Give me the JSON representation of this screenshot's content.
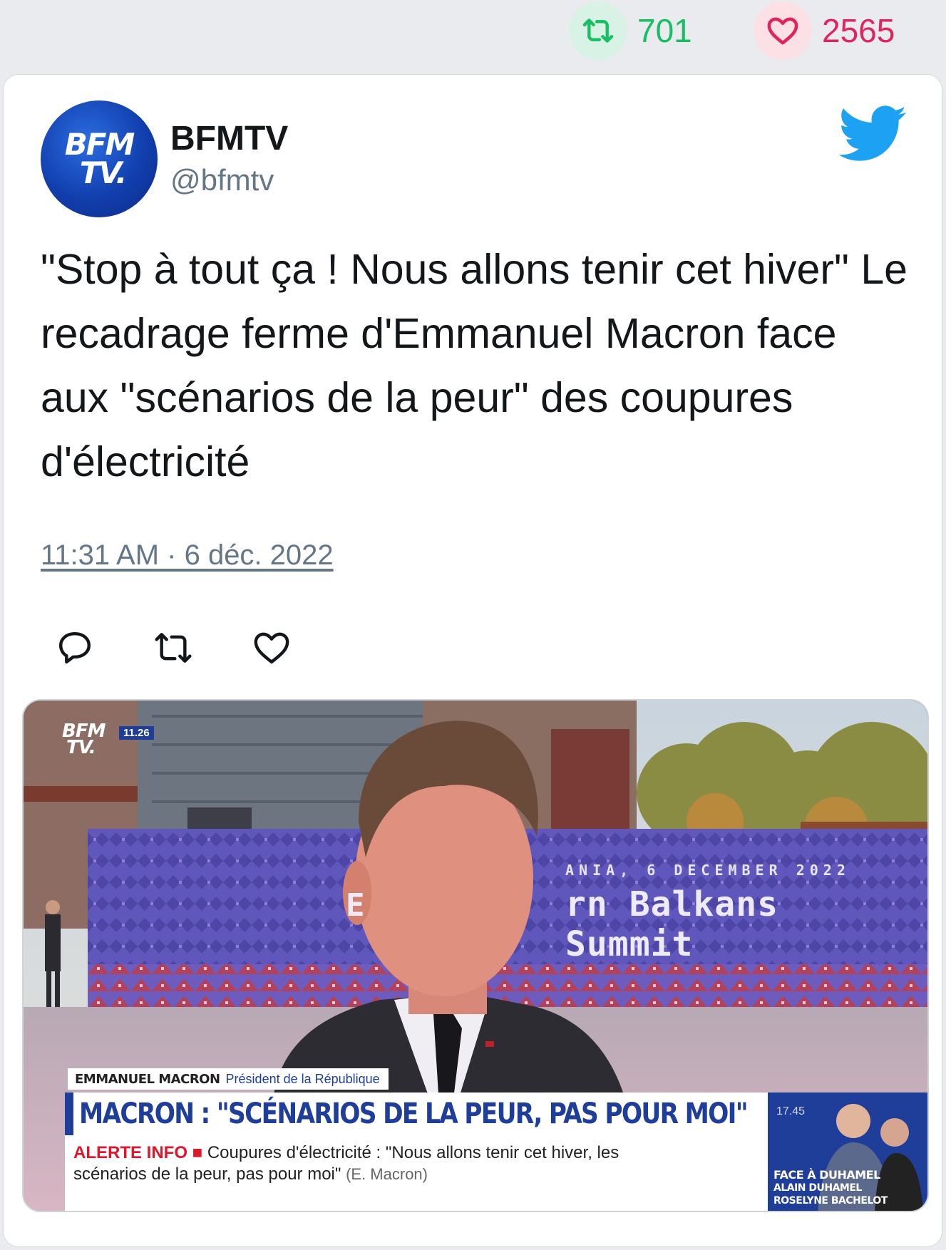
{
  "stats": {
    "retweets": "701",
    "likes": "2565",
    "retweet_icon": "retweet-icon",
    "like_icon": "heart-icon",
    "retweet_color": "#17bf63",
    "like_color": "#e0245e"
  },
  "tweet": {
    "avatar_text_line1": "BFM",
    "avatar_text_line2": "TV.",
    "name": "BFMTV",
    "handle": "@bfmtv",
    "text": "\"Stop à tout ça ! Nous allons tenir cet hiver\" Le recadrage ferme d'Emmanuel Macron face aux \"scénarios de la peur\" des coupures d'électricité",
    "timestamp": "11:31 AM · 6 déc. 2022",
    "brand_icon": "twitter-bird-icon",
    "brand_color": "#1da1f2",
    "actions": [
      "reply-icon",
      "retweet-icon",
      "like-icon"
    ]
  },
  "media": {
    "bug_line1": "BFM",
    "bug_line2": "TV.",
    "clock": "11.26",
    "summit_date": "ANIA, 6 DECEMBER 2022",
    "summit_prefix": "E",
    "summit_title": "rn Balkans Summit",
    "person_name": "EMMANUEL MACRON",
    "person_role": "Président de la République",
    "headline": "MACRON : \"SCÉNARIOS DE LA PEUR, PAS POUR MOI\"",
    "alert_tag": "ALERTE INFO",
    "alert_text": "Coupures d'électricité : \"Nous allons tenir cet hiver, les scénarios de la peur, pas pour moi\"",
    "alert_source": "(E. Macron)",
    "promo_time": "17.45",
    "promo_title": "FACE À DUHAMEL",
    "promo_guest1": "ALAIN DUHAMEL",
    "promo_guest2": "ROSELYNE BACHELOT",
    "accent": "#1e3e9a",
    "alert_color": "#e2162a"
  }
}
